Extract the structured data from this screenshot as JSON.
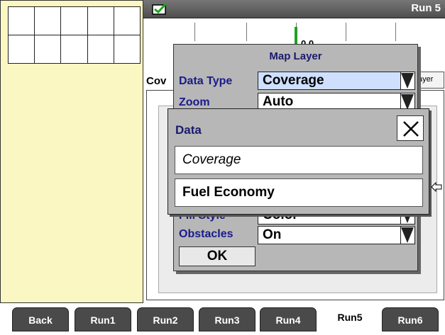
{
  "top_bar": {
    "title": "Run 5"
  },
  "map": {
    "marker_text": "0.0 ",
    "coverage_label": "Cov",
    "layer_button_label": "ayer"
  },
  "map_layer_dialog": {
    "title": "Map Layer",
    "rows": [
      {
        "label": "Data Type",
        "value": "Coverage"
      },
      {
        "label": "Zoom",
        "value": "Auto"
      },
      {
        "label": "Fill Style",
        "value": "Color"
      },
      {
        "label": "Obstacles",
        "value": "On"
      }
    ],
    "ok_label": "OK"
  },
  "data_popup": {
    "title": "Data",
    "options": [
      "Coverage",
      "Fuel Economy"
    ],
    "selected_index": 1
  },
  "tabs": [
    {
      "label": "Back",
      "active": false
    },
    {
      "label": "Run1",
      "active": false
    },
    {
      "label": "Run2",
      "active": false
    },
    {
      "label": "Run3",
      "active": false
    },
    {
      "label": "Run4",
      "active": false
    },
    {
      "label": "Run5",
      "active": true
    },
    {
      "label": "Run6",
      "active": false
    }
  ],
  "colors": {
    "panel_yellow": "#fbf7c3",
    "dialog_gray": "#b7b7b7",
    "label_blue": "#1a1a8c",
    "tab_dark": "#4a4a4a",
    "check_green": "#1fa21f"
  }
}
